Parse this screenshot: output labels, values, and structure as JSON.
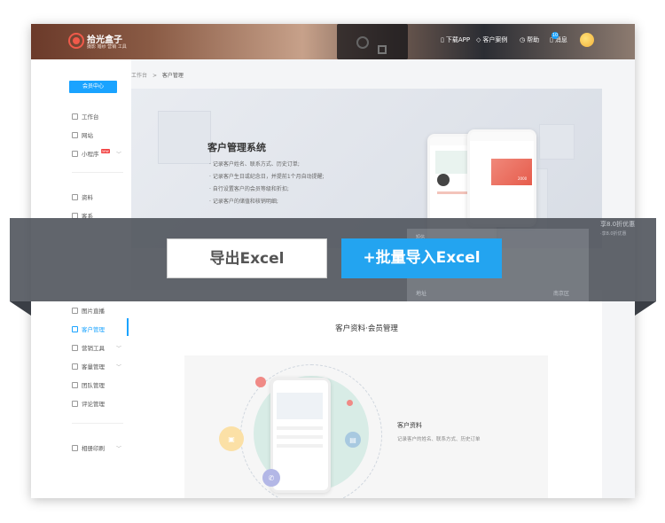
{
  "header": {
    "brand": "拾光盒子",
    "brand_sub": "摄影 婚纱 营销 工具",
    "nav": [
      {
        "label": "下载APP",
        "icon": "phone-icon"
      },
      {
        "label": "客户案例",
        "icon": "cube-icon"
      },
      {
        "label": "帮助",
        "icon": "clock-icon"
      },
      {
        "label": "消息",
        "icon": "bell-icon"
      }
    ],
    "msg_count": "10"
  },
  "sidebar": {
    "vip_label": "会员中心",
    "items": [
      {
        "label": "工作台"
      },
      {
        "label": "网站"
      },
      {
        "label": "小程序",
        "badge": "new"
      },
      {
        "label": "资料"
      },
      {
        "label": "客系"
      },
      {
        "label": "图片直播"
      },
      {
        "label": "客户管理"
      },
      {
        "label": "营销工具"
      },
      {
        "label": "客量管理"
      },
      {
        "label": "团队管理"
      },
      {
        "label": "评论管理"
      },
      {
        "label": "相册印刷"
      }
    ]
  },
  "breadcrumb": {
    "root": "工作台",
    "sep": ">",
    "current": "客户管理"
  },
  "hero": {
    "title": "客户管理系统",
    "lines": [
      "· 记录客户姓名、联系方式、历史订单;",
      "· 记录客户生日或纪念日，并提前1个月自动提醒;",
      "· 自行设置客户的会员等级和折扣;",
      "· 记录客户的储值和核销明细;"
    ],
    "phone_amount": "2000"
  },
  "overlay": {
    "export_label": "导出Excel",
    "import_label": "+批量导入Excel",
    "peek_right": "享8.0折优惠",
    "peek_right2": "·享8.0折优惠",
    "peek_mid": "短信",
    "peek_addr": "地址",
    "peek_addr_v": "南京区"
  },
  "section": {
    "title": "客户资料·会员管理",
    "feature_title": "客户资料",
    "feature_desc": "记录客户的姓名、联系方式、历史订单"
  }
}
